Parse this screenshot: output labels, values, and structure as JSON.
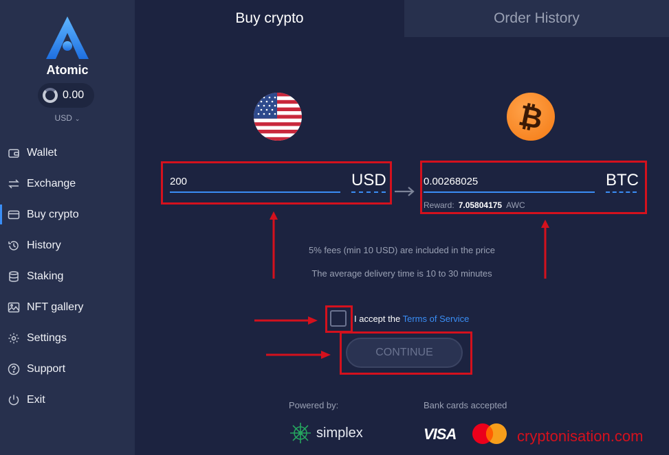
{
  "sidebar": {
    "brand": "Atomic",
    "balance": "0.00",
    "currency": "USD",
    "items": [
      {
        "label": "Wallet",
        "icon": "wallet-icon"
      },
      {
        "label": "Exchange",
        "icon": "exchange-icon"
      },
      {
        "label": "Buy crypto",
        "icon": "card-icon",
        "active": true
      },
      {
        "label": "History",
        "icon": "history-icon"
      },
      {
        "label": "Staking",
        "icon": "staking-icon"
      },
      {
        "label": "NFT gallery",
        "icon": "image-icon"
      },
      {
        "label": "Settings",
        "icon": "gear-icon"
      },
      {
        "label": "Support",
        "icon": "help-icon"
      },
      {
        "label": "Exit",
        "icon": "power-icon"
      }
    ]
  },
  "tabs": {
    "buy": "Buy crypto",
    "history": "Order History"
  },
  "form": {
    "from_amount": "200",
    "from_currency": "USD",
    "to_amount": "0.00268025",
    "to_currency": "BTC",
    "reward_label": "Reward:",
    "reward_value": "7.05804175",
    "reward_unit": "AWC"
  },
  "info": {
    "fees": "5% fees (min 10 USD) are included in the price",
    "delivery": "The average delivery time is 10 to 30 minutes"
  },
  "terms": {
    "prefix": "I accept the",
    "link": "Terms of Service"
  },
  "continue_label": "CONTINUE",
  "footer": {
    "powered_by": "Powered by:",
    "bank_cards": "Bank cards accepted",
    "simplex": "simplex",
    "visa": "VISA"
  },
  "watermark": "cryptonisation.com",
  "colors": {
    "background": "#1c2340",
    "sidebar": "#27304d",
    "accent": "#3a8ef6",
    "annotation": "#d4111d",
    "btc": "#f7931a"
  }
}
